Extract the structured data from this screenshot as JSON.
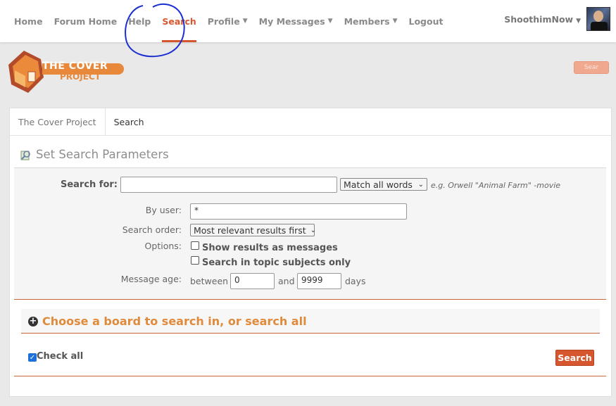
{
  "nav": {
    "items": [
      {
        "label": "Home",
        "caret": ""
      },
      {
        "label": "Forum Home",
        "caret": ""
      },
      {
        "label": "Help",
        "caret": ""
      },
      {
        "label": "Search",
        "caret": ""
      },
      {
        "label": "Profile",
        "caret": "▼"
      },
      {
        "label": "My Messages",
        "caret": "▼"
      },
      {
        "label": "Members",
        "caret": "▼"
      },
      {
        "label": "Logout",
        "caret": ""
      }
    ],
    "user": "ShoothimNow",
    "user_caret": "▼"
  },
  "logo": {
    "line1": "THE COVER",
    "line2": "PROJECT"
  },
  "header_search_label": "Sear",
  "breadcrumb": {
    "first": "The Cover Project",
    "current": "Search"
  },
  "section_title": "Set Search Parameters",
  "form": {
    "search_for_label": "Search for:",
    "search_for_value": "",
    "match_select": "Match all words",
    "hint": "e.g. Orwell \"Animal Farm\" -movie",
    "by_user_label": "By user:",
    "by_user_value": "*",
    "order_label": "Search order:",
    "order_select": "Most relevant results first",
    "options_label": "Options:",
    "option1": "Show results as messages",
    "option2": "Search in topic subjects only",
    "age_label": "Message age:",
    "between": "between",
    "age_from": "0",
    "and": "and",
    "age_to": "9999",
    "days": "days"
  },
  "boards": {
    "title": "Choose a board to search in, or search all",
    "check_all": "Check all",
    "search_button": "Search"
  },
  "colors": {
    "accent": "#d6562f",
    "orange_text": "#e08a3b",
    "annotation": "#1a2fd1"
  }
}
